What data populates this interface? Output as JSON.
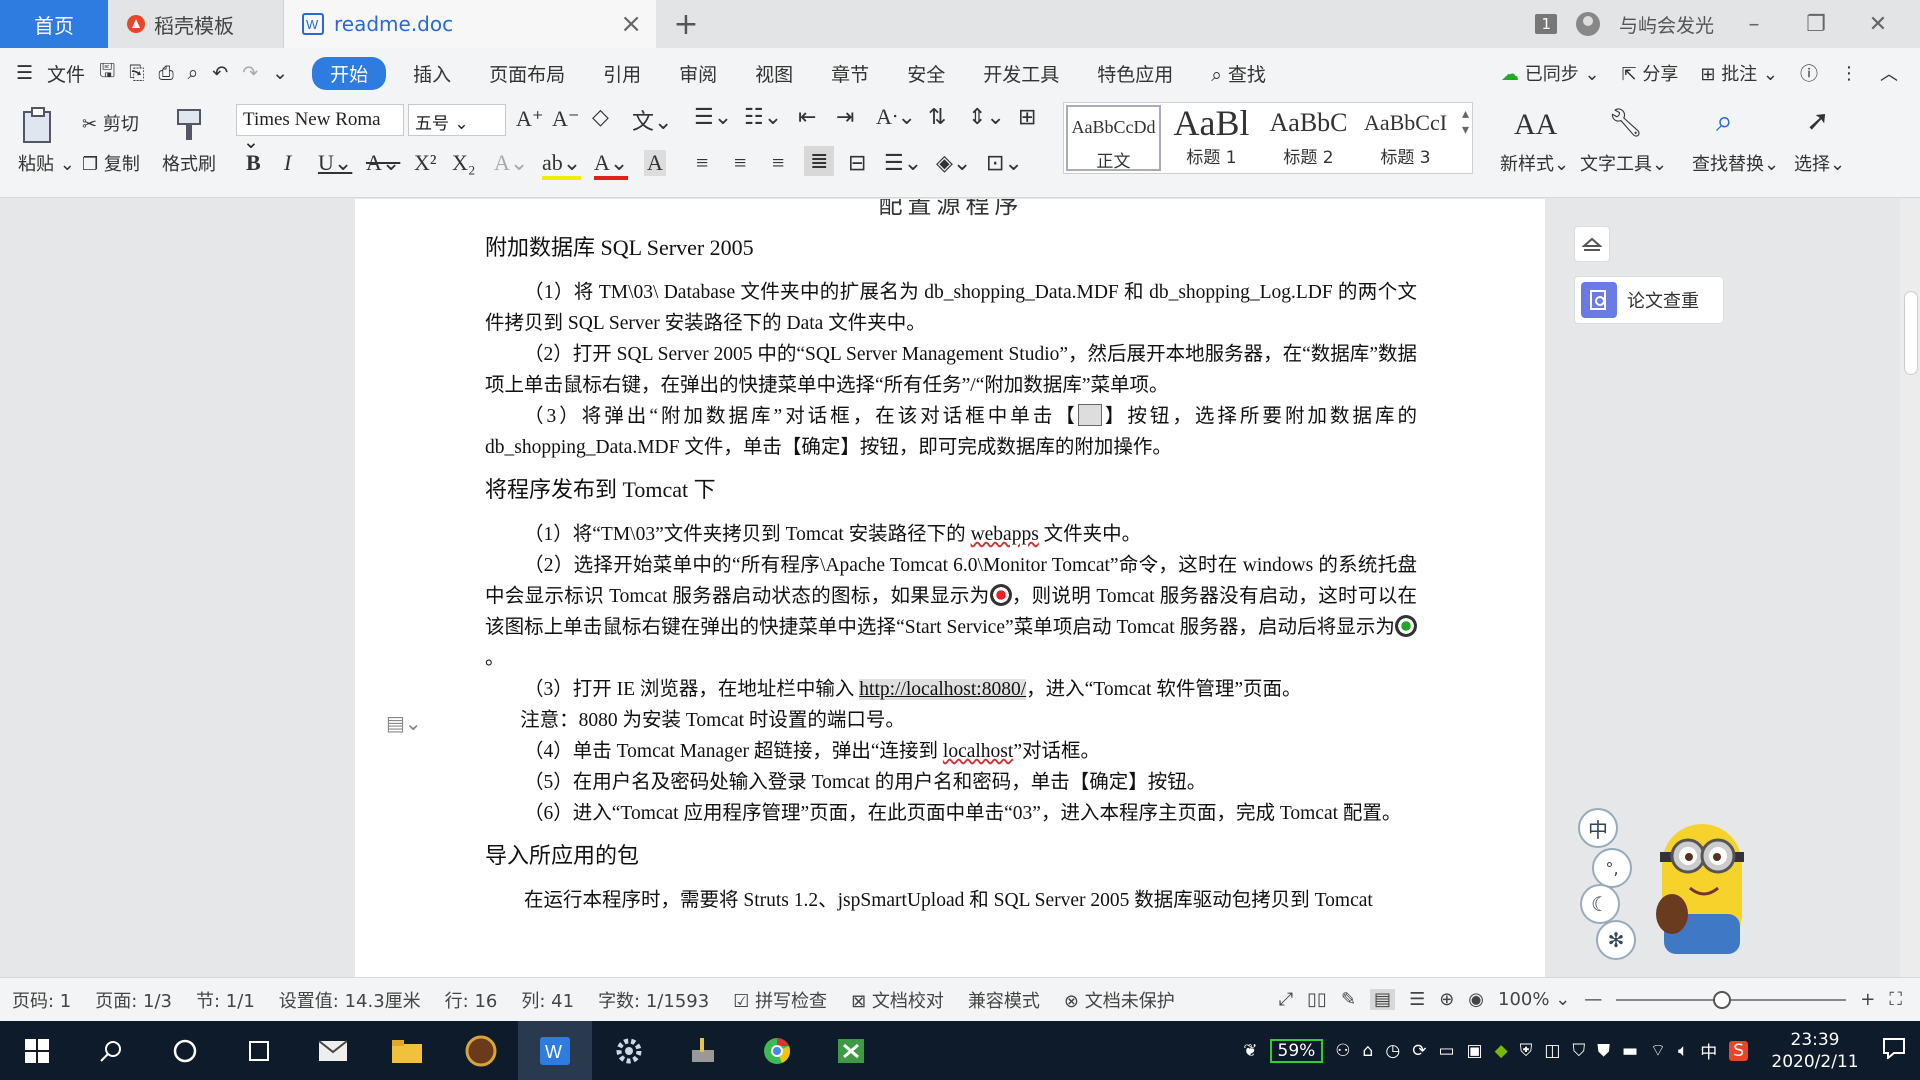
{
  "tabs": {
    "home": "首页",
    "template": "稻壳模板",
    "doc": "readme.doc",
    "badge": "1",
    "user": "与屿会发光"
  },
  "menu": {
    "file": "文件",
    "items": [
      "开始",
      "插入",
      "页面布局",
      "引用",
      "审阅",
      "视图",
      "章节",
      "安全",
      "开发工具",
      "特色应用"
    ],
    "search": "查找",
    "sync": "已同步",
    "share": "分享",
    "comment": "批注"
  },
  "ribbon": {
    "paste": "粘贴",
    "cut": "剪切",
    "copy": "复制",
    "format_painter": "格式刷",
    "font_name": "Times New Roma",
    "font_size": "五号",
    "styles": [
      {
        "sample": "AaBbCcDd",
        "label": "正文"
      },
      {
        "sample": "AaBl",
        "label": "标题 1"
      },
      {
        "sample": "AaBbC",
        "label": "标题 2"
      },
      {
        "sample": "AaBbCcI",
        "label": "标题 3"
      }
    ],
    "new_style": "新样式",
    "text_tool": "文字工具",
    "find_replace": "查找替换",
    "select": "选择"
  },
  "doc": {
    "title": "配置源程序",
    "h_attach": "附加数据库 SQL Server 2005",
    "p1": "（1）将 TM\\03\\ Database 文件夹中的扩展名为 db_shopping_Data.MDF 和 db_shopping_Log.LDF 的两个文件拷贝到 SQL Server 安装路径下的 Data 文件夹中。",
    "p2": "（2）打开 SQL Server 2005 中的“SQL Server Management Studio”，然后展开本地服务器，在“数据库”数据项上单击鼠标右键，在弹出的快捷菜单中选择“所有任务”/“附加数据库”菜单项。",
    "p3a": "（3）将弹出“附加数据库”对话框，在该对话框中单击【",
    "p3b": "】按钮，选择所要附加数据库的 db_shopping_Data.MDF 文件，单击【确定】按钮，即可完成数据库的附加操作。",
    "h_tomcat": "将程序发布到 Tomcat 下",
    "t1a": "（1）将“TM\\03”文件夹拷贝到 Tomcat 安装路径下的 ",
    "t1w": "webapps",
    "t1b": " 文件夹中。",
    "t2a": "（2）选择开始菜单中的“所有程序\\Apache Tomcat 6.0\\Monitor Tomcat”命令，这时在 windows 的系统托盘中会显示标识 Tomcat 服务器启动状态的图标，如果显示为",
    "t2b": "，则说明 Tomcat 服务器没有启动，这时可以在该图标上单击鼠标右键在弹出的快捷菜单中选择“Start Service”菜单项启动 Tomcat 服务器，启动后将显示为",
    "t2c": "。",
    "t3a": "（3）打开 IE 浏览器，在地址栏中输入 ",
    "t3link": "http://localhost:8080/",
    "t3b": "，进入“Tomcat 软件管理”页面。",
    "note": "注意：8080 为安装 Tomcat 时设置的端口号。",
    "t4a": "（4）单击 Tomcat Manager 超链接，弹出“连接到 ",
    "t4w": "localhost",
    "t4b": "”对话框。",
    "t5": "（5）在用户名及密码处输入登录 Tomcat 的用户名和密码，单击【确定】按钮。",
    "t6": "（6）进入“Tomcat 应用程序管理”页面，在此页面中单击“03”，进入本程序主页面，完成 Tomcat 配置。",
    "h_pkg": "导入所应用的包",
    "pkg": "在运行本程序时，需要将 Struts 1.2、jspSmartUpload 和 SQL Server 2005 数据库驱动包拷贝到 Tomcat"
  },
  "side": {
    "paper_check": "论文查重"
  },
  "status": {
    "page_num": "页码: 1",
    "page": "页面: 1/3",
    "section": "节: 1/1",
    "setting": "设置值: 14.3厘米",
    "row": "行: 16",
    "col": "列: 41",
    "words": "字数: 1/1593",
    "spell": "拼写检查",
    "proof": "文档校对",
    "compat": "兼容模式",
    "protect": "文档未保护",
    "zoom": "100%",
    "zoom_level": 0.46
  },
  "taskbar": {
    "battery": "59%",
    "ime": "中",
    "time": "23:39",
    "date": "2020/2/11"
  },
  "ime_float": {
    "mode": "中"
  },
  "colors": {
    "accent": "#2f7ce1",
    "taskbar": "#0d1b2a"
  }
}
